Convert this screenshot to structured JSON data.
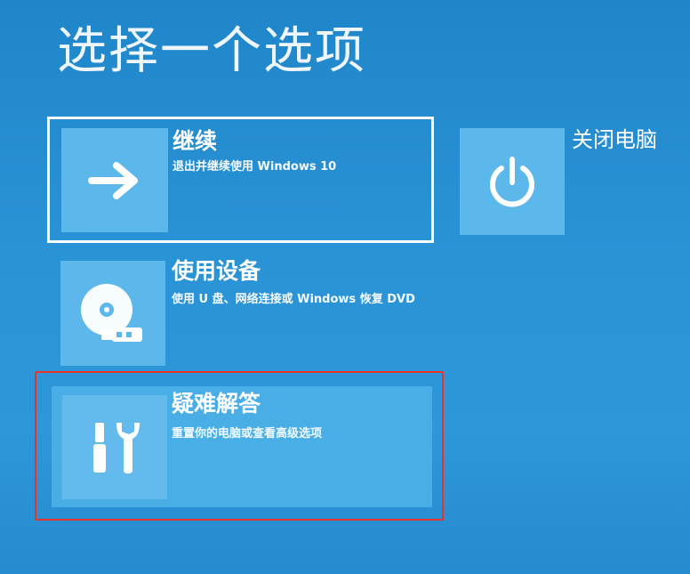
{
  "page": {
    "title": "选择一个选项"
  },
  "options": [
    {
      "id": "continue",
      "title": "继续",
      "description": "退出并继续使用 Windows 10",
      "icon": "arrow-right-icon",
      "state": "focused"
    },
    {
      "id": "use-device",
      "title": "使用设备",
      "description": "使用 U 盘、网络连接或 Windows 恢复 DVD",
      "icon": "disc-usb-icon",
      "state": "normal"
    },
    {
      "id": "troubleshoot",
      "title": "疑难解答",
      "description": "重置你的电脑或查看高级选项",
      "icon": "tools-icon",
      "state": "hover"
    }
  ],
  "shutdown": {
    "title": "关闭电脑",
    "icon": "power-icon"
  },
  "colors": {
    "background": "#2a93d6",
    "tile": "#5cb7ea",
    "highlight": "#e8332b"
  }
}
